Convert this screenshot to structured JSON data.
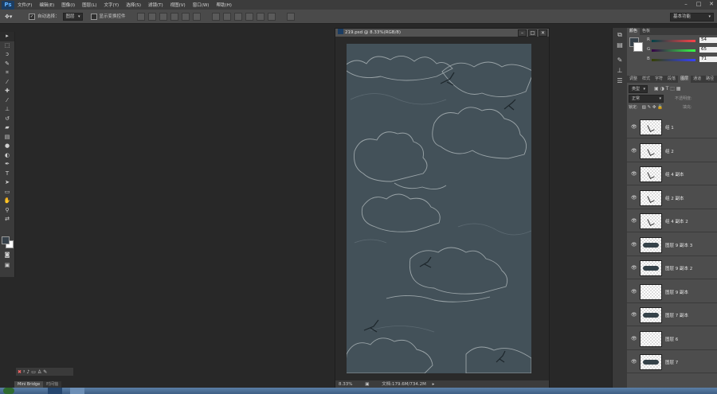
{
  "menu": {
    "logo": "Ps",
    "items": [
      "文件(F)",
      "编辑(E)",
      "图像(I)",
      "图层(L)",
      "文字(Y)",
      "选择(S)",
      "滤镜(T)",
      "视图(V)",
      "窗口(W)",
      "帮助(H)"
    ]
  },
  "options": {
    "auto_select_label": "自动选择：",
    "auto_select_value": "图层",
    "show_transform_label": "显示变换控件",
    "workspace": "基本功能"
  },
  "document": {
    "title": "219.psd @ 8.33%(RGB/8)",
    "zoom": "8.33%",
    "doc_info": "文档:179.6M/734.2M",
    "canvas_color": "#435159"
  },
  "bridge": {
    "tabs": [
      "Mini Bridge",
      "时间轴"
    ]
  },
  "color_panel": {
    "tabs": [
      "颜色",
      "色板"
    ],
    "r": "54",
    "g": "65",
    "b": "71",
    "labels": [
      "R",
      "G",
      "B"
    ]
  },
  "layers_panel": {
    "tabs": [
      "调整",
      "样式",
      "字符",
      "段落",
      "图层",
      "通道",
      "路径"
    ],
    "filter_label": "类型",
    "blend_mode": "正常",
    "opacity_label": "不透明度:",
    "lock_label": "锁定:",
    "fill_label": "填充:",
    "layers": [
      {
        "name": "组 1",
        "thumb": "bird"
      },
      {
        "name": "组 2",
        "thumb": "bird"
      },
      {
        "name": "组 4 副本",
        "thumb": "bird"
      },
      {
        "name": "组 2 副本",
        "thumb": "bird"
      },
      {
        "name": "组 4 副本 2",
        "thumb": "bird"
      },
      {
        "name": "图层 9 副本 3",
        "thumb": "dark"
      },
      {
        "name": "图层 9 副本 2",
        "thumb": "dark"
      },
      {
        "name": "图层 9 副本",
        "thumb": "plain"
      },
      {
        "name": "图层 7 副本",
        "thumb": "dark"
      },
      {
        "name": "图层 6",
        "thumb": "plain"
      },
      {
        "name": "图层 7",
        "thumb": "dark"
      }
    ]
  },
  "colors": {
    "accent": "#1c3d62",
    "fg_color": "#36414a"
  }
}
